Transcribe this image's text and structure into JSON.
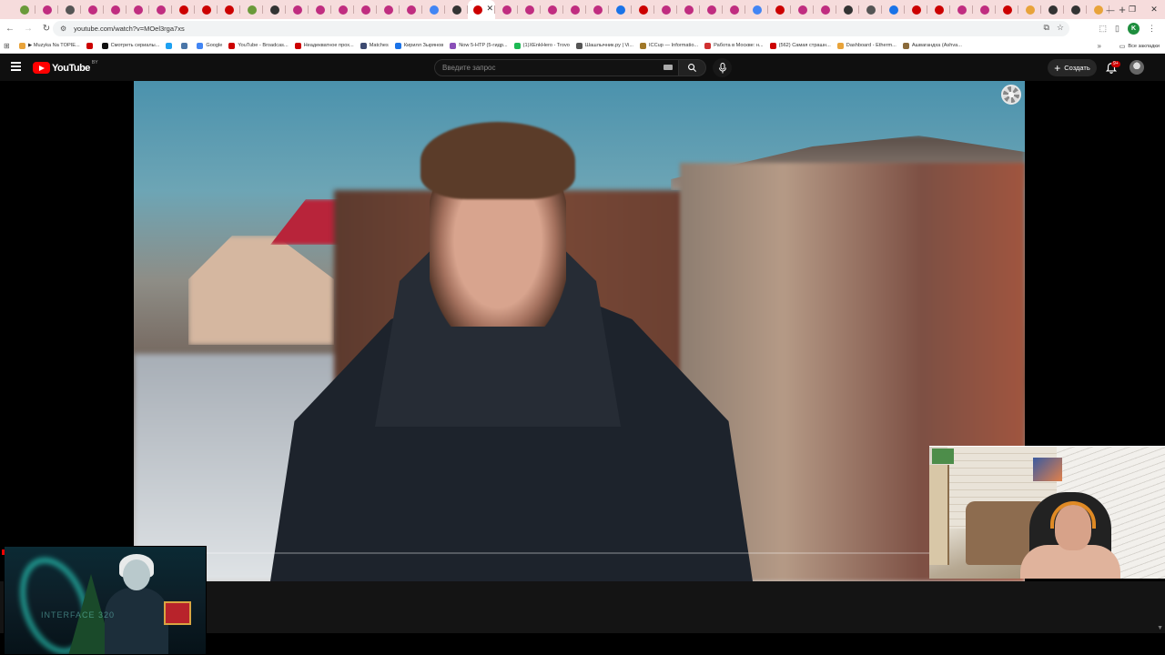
{
  "browser": {
    "tabs": [
      {
        "color": "#6a9a3a"
      },
      {
        "color": "#c02d80"
      },
      {
        "color": "#555555"
      },
      {
        "color": "#c02d80"
      },
      {
        "color": "#c02d80"
      },
      {
        "color": "#c02d80"
      },
      {
        "color": "#c02d80"
      },
      {
        "color": "#cc0000"
      },
      {
        "color": "#cc0000"
      },
      {
        "color": "#cc0000"
      },
      {
        "color": "#6a9a3a"
      },
      {
        "color": "#333333"
      },
      {
        "color": "#c02d80"
      },
      {
        "color": "#c02d80"
      },
      {
        "color": "#c02d80"
      },
      {
        "color": "#c02d80"
      },
      {
        "color": "#c02d80"
      },
      {
        "color": "#c02d80"
      },
      {
        "color": "#4285f4"
      },
      {
        "color": "#333333"
      },
      {
        "color": "#cc0000",
        "active": true
      },
      {
        "color": "#c02d80"
      },
      {
        "color": "#c02d80"
      },
      {
        "color": "#c02d80"
      },
      {
        "color": "#c02d80"
      },
      {
        "color": "#c02d80"
      },
      {
        "color": "#1a73e8"
      },
      {
        "color": "#cc0000"
      },
      {
        "color": "#c02d80"
      },
      {
        "color": "#c02d80"
      },
      {
        "color": "#c02d80"
      },
      {
        "color": "#c02d80"
      },
      {
        "color": "#4285f4"
      },
      {
        "color": "#cc0000"
      },
      {
        "color": "#c02d80"
      },
      {
        "color": "#c02d80"
      },
      {
        "color": "#333333"
      },
      {
        "color": "#555555"
      },
      {
        "color": "#1a73e8"
      },
      {
        "color": "#cc0000"
      },
      {
        "color": "#cc0000"
      },
      {
        "color": "#c02d80"
      },
      {
        "color": "#c02d80"
      },
      {
        "color": "#cc0000"
      },
      {
        "color": "#e8a33a"
      },
      {
        "color": "#333333"
      },
      {
        "color": "#333333"
      },
      {
        "color": "#e8a33a"
      }
    ],
    "url": "youtube.com/watch?v=MOel3rga7xs",
    "profile_initial": "K",
    "bookmarks": [
      {
        "label": "▶ Muzyka Na TOPIE...",
        "color": "#e8a33a"
      },
      {
        "label": "",
        "color": "#cc0000"
      },
      {
        "label": "Смотреть сериалы...",
        "color": "#111111"
      },
      {
        "label": "",
        "color": "#1da1f2"
      },
      {
        "label": "",
        "color": "#4a76a8"
      },
      {
        "label": "Google",
        "color": "#4285f4"
      },
      {
        "label": "YouTube - Broadcas...",
        "color": "#cc0000"
      },
      {
        "label": "Неадекватное прох...",
        "color": "#cc0000"
      },
      {
        "label": "Matches",
        "color": "#3d4a70"
      },
      {
        "label": "Кирилл Зырянов",
        "color": "#1a73e8"
      },
      {
        "label": "Now 5-HTP (5-гидр...",
        "color": "#8a4fb8"
      },
      {
        "label": "(1)XEnkHero - Trovo",
        "color": "#1db954"
      },
      {
        "label": "Шашлычник.ру | Vi...",
        "color": "#555555"
      },
      {
        "label": "ICCup — Informatio...",
        "color": "#a07828"
      },
      {
        "label": "Работа в Москве: н...",
        "color": "#d03030"
      },
      {
        "label": "(562) Самая страшн...",
        "color": "#cc0000"
      },
      {
        "label": "Dashboard - Etherm...",
        "color": "#e8a33a"
      },
      {
        "label": "Ашвагандха (Ashva...",
        "color": "#8a6a3a"
      }
    ],
    "all_bookmarks_label": "Все закладки"
  },
  "youtube": {
    "logo_text": "YouTube",
    "region": "BY",
    "search_placeholder": "Введите запрос",
    "create_label": "Создать",
    "notification_count": "9+"
  },
  "overlay": {
    "art_text": "INTERFACE 320"
  }
}
